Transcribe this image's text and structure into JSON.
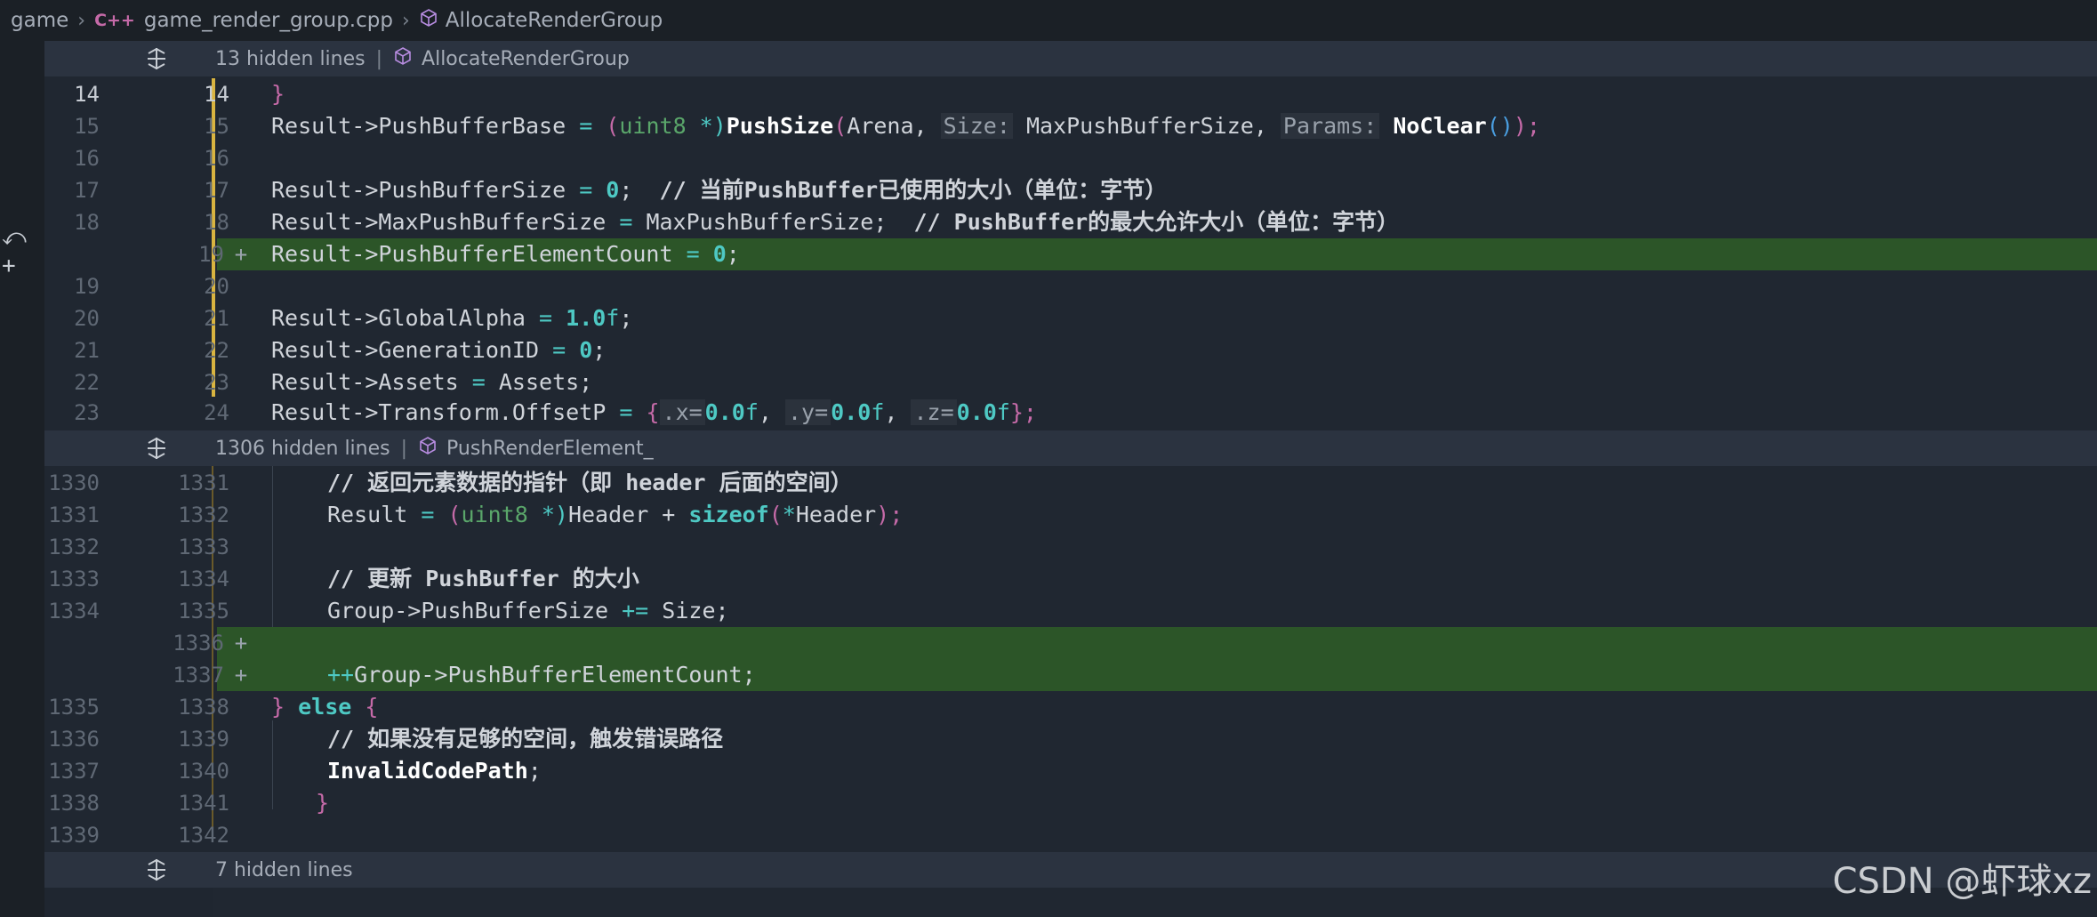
{
  "breadcrumb": {
    "root": "game",
    "lang_icon": "C++",
    "file": "game_render_group.cpp",
    "symbol": "AllocateRenderGroup"
  },
  "folds": [
    {
      "hidden": "13 hidden lines",
      "symbol": "AllocateRenderGroup"
    },
    {
      "hidden": "1306 hidden lines",
      "symbol": "PushRenderElement_"
    },
    {
      "hidden": "7 hidden lines",
      "symbol": ""
    }
  ],
  "hunk1": {
    "old": [
      "14",
      "15",
      "16",
      "17",
      "18",
      "",
      "19",
      "20",
      "21",
      "22",
      "23"
    ],
    "new": [
      "14",
      "15",
      "16",
      "17",
      "18",
      "19",
      "20",
      "21",
      "22",
      "23",
      "24"
    ],
    "added_mark": "+"
  },
  "hunk2": {
    "old": [
      "1330",
      "1331",
      "1332",
      "1333",
      "1334",
      "",
      "",
      "1335",
      "1336",
      "1337",
      "1338",
      "1339"
    ],
    "new": [
      "1331",
      "1332",
      "1333",
      "1334",
      "1335",
      "1336",
      "1337",
      "1338",
      "1339",
      "1340",
      "1341",
      "1342"
    ],
    "added_mark": "+"
  },
  "code": {
    "brace_close": "}",
    "result_arrow": "Result->",
    "push_buffer_base": "PushBufferBase",
    "eq": " = ",
    "uint8_ptr_open": "(",
    "uint8": "uint8",
    "ptr_close": " *)",
    "push_size": "PushSize",
    "paren_open": "(",
    "arena": "Arena, ",
    "size_hint": "Size:",
    "max_push": " MaxPushBufferSize, ",
    "params_hint": "Params:",
    "no_clear": " NoClear",
    "call_empty": "()",
    "paren_close_semi": ");",
    "l17_a": "Result->PushBufferSize",
    "zero": "0",
    "semi": ";",
    "l17_comment": "  // 当前PushBuffer已使用的大小（单位：字节）",
    "l18_a": "Result->MaxPushBufferSize",
    "l18_b": "MaxPushBufferSize;",
    "l18_comment": "  // PushBuffer的最大允许大小（单位：字节）",
    "l19_a": "Result->PushBufferElementCount",
    "l21_a": "Result->GlobalAlpha",
    "one_f": "1.0",
    "f": "f",
    "l22_a": "Result->GenerationID",
    "l23_a": "Result->Assets",
    "l23_b": "Assets;",
    "l24_a": "Result->Transform.OffsetP",
    "brace_open": "{",
    "x_hint": ".x=",
    "y_hint": ".y=",
    "z_hint": ".z=",
    "zero_f": "0.0",
    "comma": ", ",
    "brace_close_semi": "};",
    "c1331": "// 返回元素数据的指针（即 header 后面的空间）",
    "l1332_a": "Result",
    "header_plus": "Header + ",
    "sizeof": "sizeof",
    "star": "*",
    "header_close": "Header",
    "c1334": "// 更新 PushBuffer 的大小",
    "l1335_a": "Group->PushBufferSize",
    "plus_eq": " += ",
    "size_semi": "Size;",
    "incr": "++",
    "l1337_b": "Group->PushBufferElementCount;",
    "else_kw": " else ",
    "c1339": "// 如果没有足够的空间，触发错误路径",
    "invalid": "InvalidCodePath",
    "semi2": ";"
  },
  "watermark": "CSDN @虾球xz",
  "colors": {
    "added_bg": "#2c5528",
    "editor_bg": "#202731",
    "fold_bar": "#2b3340",
    "modified_marker": "#d9b440"
  }
}
